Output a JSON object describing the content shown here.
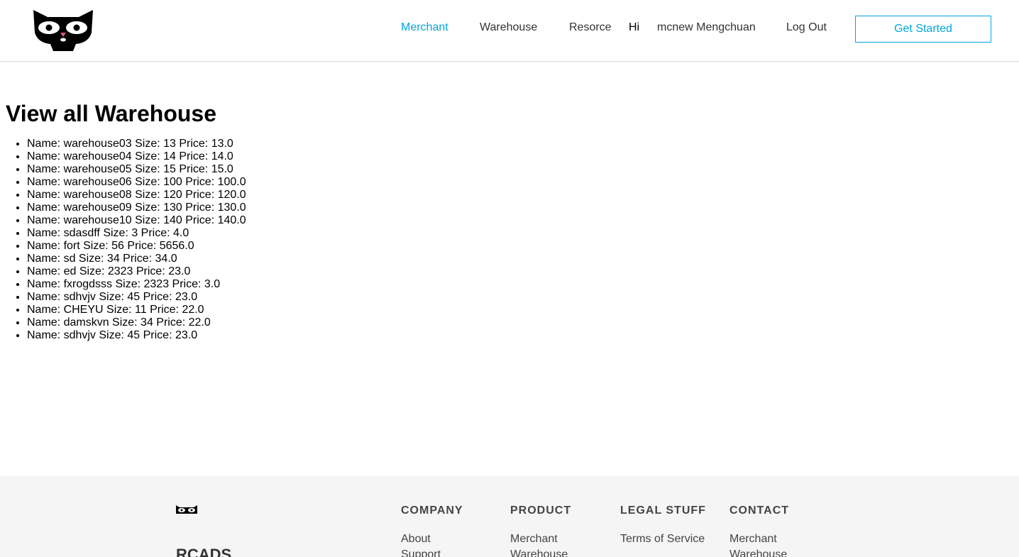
{
  "header": {
    "nav": {
      "merchant": "Merchant",
      "warehouse": "Warehouse",
      "resource": "Resorce",
      "greeting": "Hi",
      "username": "mcnew Mengchuan",
      "logout": "Log Out",
      "cta": "Get Started"
    },
    "accent_color": "#00a6de",
    "logo_icon": "cat-face-logo-icon"
  },
  "main": {
    "title": "View all Warehouse",
    "warehouses": [
      "Name: warehouse03 Size: 13 Price: 13.0",
      "Name: warehouse04 Size: 14 Price: 14.0",
      "Name: warehouse05 Size: 15 Price: 15.0",
      "Name: warehouse06 Size: 100 Price: 100.0",
      "Name: warehouse08 Size: 120 Price: 120.0",
      "Name: warehouse09 Size: 130 Price: 130.0",
      "Name: warehouse10 Size: 140 Price: 140.0",
      "Name: sdasdff Size: 3 Price: 4.0",
      "Name: fort Size: 56 Price: 5656.0",
      "Name: sd Size: 34 Price: 34.0",
      "Name: ed Size: 2323 Price: 23.0",
      "Name: fxrogdsss Size: 2323 Price: 3.0",
      "Name: sdhvjv Size: 45 Price: 23.0",
      "Name: CHEYU Size: 11 Price: 22.0",
      "Name: damskvn Size: 34 Price: 22.0",
      "Name: sdhvjv Size: 45 Price: 23.0"
    ]
  },
  "footer": {
    "brand": "RCADS",
    "logo_icon": "cat-eyes-logo-icon",
    "columns": {
      "company": {
        "heading": "COMPANY",
        "links": [
          "About",
          "Support"
        ]
      },
      "product": {
        "heading": "PRODUCT",
        "links": [
          "Merchant",
          "Warehouse"
        ]
      },
      "legal": {
        "heading": "LEGAL STUFF",
        "links": [
          "Terms of Service"
        ]
      },
      "contact": {
        "heading": "CONTACT",
        "links": [
          "Merchant",
          "Warehouse"
        ]
      }
    }
  }
}
